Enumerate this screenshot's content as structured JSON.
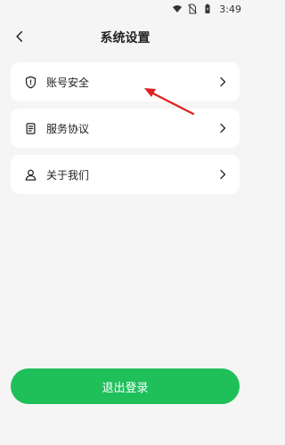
{
  "status_bar": {
    "time": "3:49",
    "icons": [
      "wifi-icon",
      "no-sim-icon",
      "battery-icon"
    ]
  },
  "header": {
    "title": "系统设置",
    "back_icon": "chevron-left-icon"
  },
  "settings": {
    "items": [
      {
        "label": "账号安全",
        "icon": "shield-icon"
      },
      {
        "label": "服务协议",
        "icon": "document-icon"
      },
      {
        "label": "关于我们",
        "icon": "user-icon"
      }
    ]
  },
  "annotation": {
    "arrow_color": "#e02020"
  },
  "logout": {
    "label": "退出登录",
    "color": "#1fbf5a"
  }
}
